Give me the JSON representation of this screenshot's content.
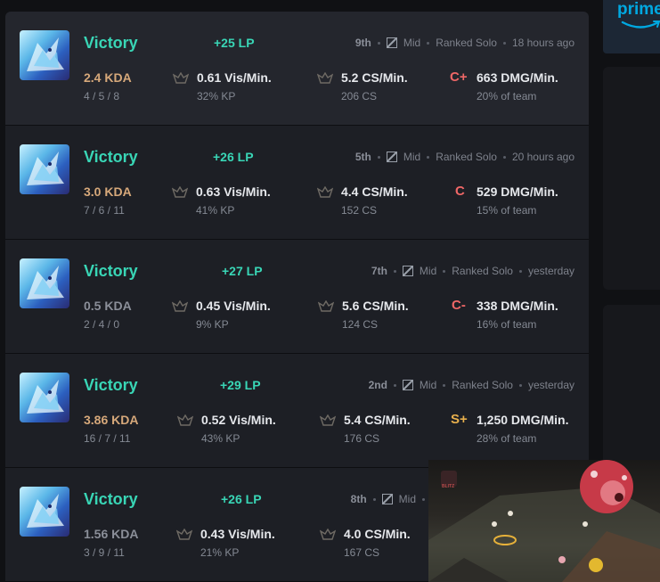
{
  "matches": [
    {
      "result": "Victory",
      "lp": "+25 LP",
      "place": "9th",
      "role": "Mid",
      "queue": "Ranked Solo",
      "time": "18 hours ago",
      "kda": "2.4 KDA",
      "kda_line": "4 / 5 / 8",
      "vision": "0.61 Vis/Min.",
      "kp": "32% KP",
      "cs_rate": "5.2 CS/Min.",
      "cs": "206 CS",
      "grade": "C+",
      "grade_color": "#ef6767",
      "dmg": "663 DMG/Min.",
      "team_share": "20% of team"
    },
    {
      "result": "Victory",
      "lp": "+26 LP",
      "place": "5th",
      "role": "Mid",
      "queue": "Ranked Solo",
      "time": "20 hours ago",
      "kda": "3.0 KDA",
      "kda_line": "7 / 6 / 11",
      "vision": "0.63 Vis/Min.",
      "kp": "41% KP",
      "cs_rate": "4.4 CS/Min.",
      "cs": "152 CS",
      "grade": "C",
      "grade_color": "#ef6767",
      "dmg": "529 DMG/Min.",
      "team_share": "15% of team"
    },
    {
      "result": "Victory",
      "lp": "+27 LP",
      "place": "7th",
      "role": "Mid",
      "queue": "Ranked Solo",
      "time": "yesterday",
      "kda": "0.5 KDA",
      "kda_line": "2 / 4 / 0",
      "vision": "0.45 Vis/Min.",
      "kp": "9% KP",
      "cs_rate": "5.6 CS/Min.",
      "cs": "124 CS",
      "grade": "C-",
      "grade_color": "#ef6767",
      "dmg": "338 DMG/Min.",
      "team_share": "16% of team"
    },
    {
      "result": "Victory",
      "lp": "+29 LP",
      "place": "2nd",
      "role": "Mid",
      "queue": "Ranked Solo",
      "time": "yesterday",
      "kda": "3.86 KDA",
      "kda_line": "16 / 7 / 11",
      "vision": "0.52 Vis/Min.",
      "kp": "43% KP",
      "cs_rate": "5.4 CS/Min.",
      "cs": "176 CS",
      "grade": "S+",
      "grade_color": "#e8b04d",
      "dmg": "1,250 DMG/Min.",
      "team_share": "28% of team"
    },
    {
      "result": "Victory",
      "lp": "+26 LP",
      "place": "8th",
      "role": "Mid",
      "kda": "1.56 KDA",
      "kda_line": "3 / 9 / 11",
      "vision": "0.43 Vis/Min.",
      "kp": "21% KP",
      "cs_rate": "4.0 CS/Min.",
      "cs": "167 CS"
    }
  ],
  "sidebar": {
    "ad_brand": "prime"
  },
  "overlay": {
    "app_logo": "BLITZ"
  },
  "icons": {
    "role": "mid-lane-icon",
    "vision": "ward-icon"
  },
  "colors": {
    "victory": "#39d6b6",
    "kda_good": "#d6a87a",
    "grade_low": "#ef6767",
    "grade_high": "#e8b04d",
    "prime": "#00a8e1"
  }
}
